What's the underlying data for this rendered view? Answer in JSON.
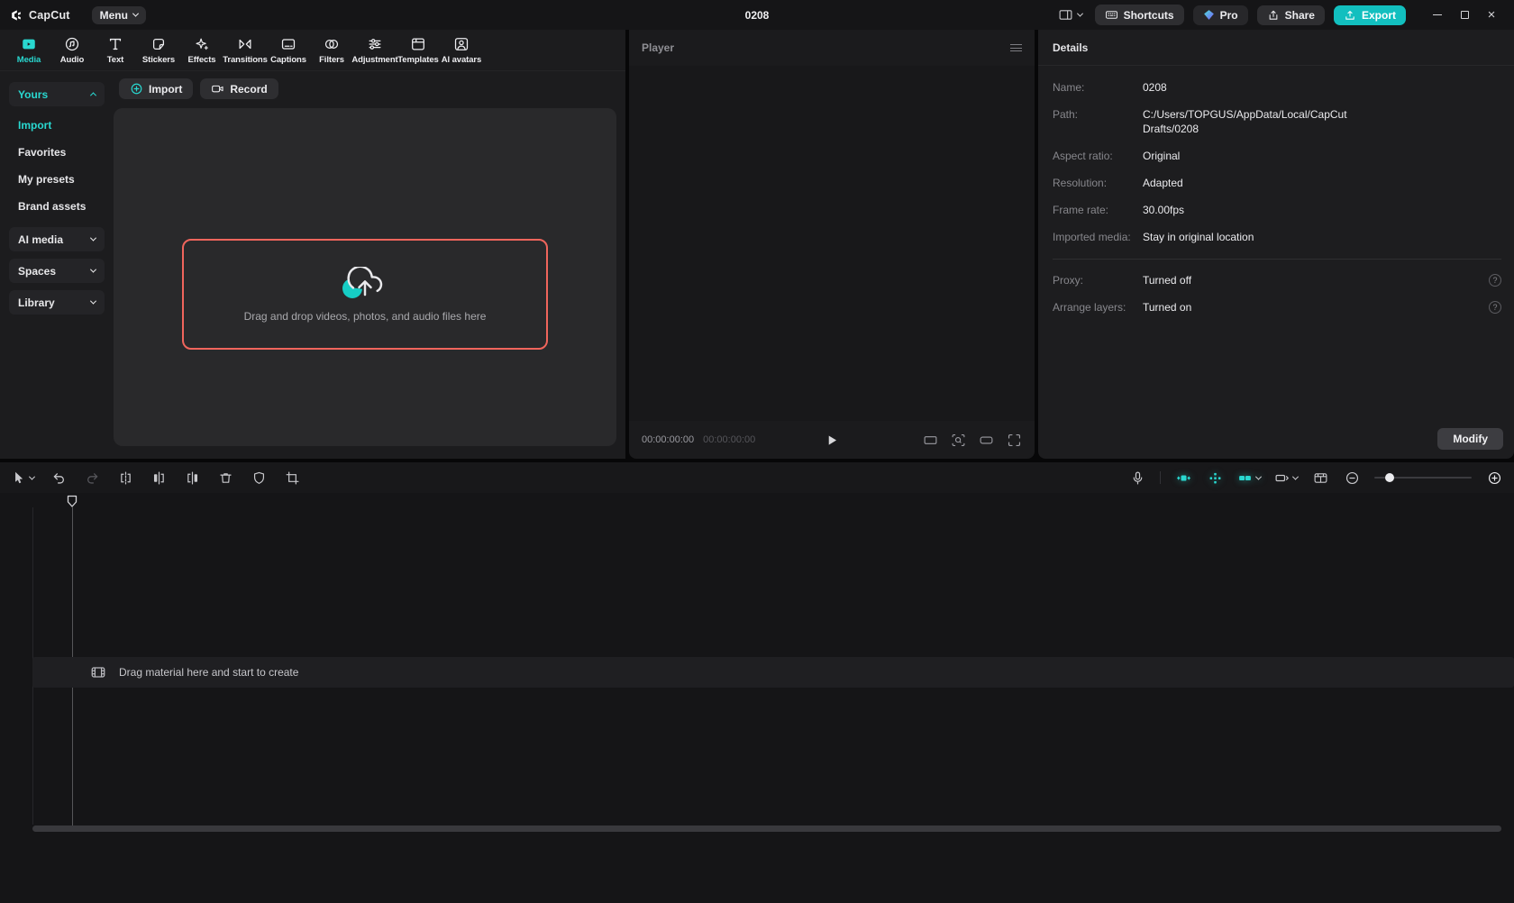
{
  "titlebar": {
    "app_name": "CapCut",
    "menu_label": "Menu",
    "project_title": "0208",
    "shortcuts_label": "Shortcuts",
    "pro_label": "Pro",
    "share_label": "Share",
    "export_label": "Export"
  },
  "tabs": {
    "items": [
      "Media",
      "Audio",
      "Text",
      "Stickers",
      "Effects",
      "Transitions",
      "Captions",
      "Filters",
      "Adjustment",
      "Templates",
      "AI avatars"
    ],
    "active": "Media"
  },
  "sidebar": {
    "yours_label": "Yours",
    "items": [
      "Import",
      "Favorites",
      "My presets",
      "Brand assets"
    ],
    "selected": "Import",
    "groups": [
      "AI media",
      "Spaces",
      "Library"
    ]
  },
  "media_panel": {
    "import_label": "Import",
    "record_label": "Record",
    "dropzone_text": "Drag and drop videos, photos, and audio files here"
  },
  "player": {
    "title": "Player",
    "current_time": "00:00:00:00",
    "total_time": "00:00:00:00"
  },
  "details": {
    "title": "Details",
    "rows": [
      {
        "label": "Name:",
        "value": "0208"
      },
      {
        "label": "Path:",
        "value": "C:/Users/TOPGUS/AppData/Local/CapCut Drafts/0208"
      },
      {
        "label": "Aspect ratio:",
        "value": "Original"
      },
      {
        "label": "Resolution:",
        "value": "Adapted"
      },
      {
        "label": "Frame rate:",
        "value": "30.00fps"
      },
      {
        "label": "Imported media:",
        "value": "Stay in original location"
      }
    ],
    "toggle_rows": [
      {
        "label": "Proxy:",
        "value": "Turned off"
      },
      {
        "label": "Arrange layers:",
        "value": "Turned on"
      }
    ],
    "help_glyph": "?",
    "modify_label": "Modify"
  },
  "timeline": {
    "empty_text": "Drag material here and start to create"
  },
  "colors": {
    "accent": "#29d8d0",
    "export_button": "#12bfbf",
    "dropzone_border": "#f0655c",
    "panel_bg": "#1c1c1e",
    "timeline_bg": "#151517"
  }
}
